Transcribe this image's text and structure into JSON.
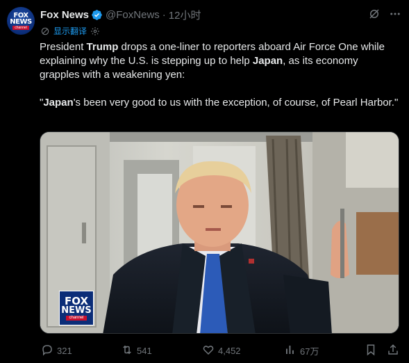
{
  "tweet": {
    "author_name": "Fox News",
    "handle": "@FoxNews",
    "separator": "·",
    "time": "12小时",
    "translate_label": "显示翻译",
    "text": {
      "p1_a": "President ",
      "p1_b": "Trump",
      "p1_c": " drops a one-liner to reporters aboard Air Force One while explaining why the U.S. is stepping up to help ",
      "p1_d": "Japan",
      "p1_e": ", as its economy grapples with a weakening yen:",
      "p2_a": "\"",
      "p2_b": "Japan",
      "p2_c": "'s been very good to us with the exception, of course, of Pearl Harbor.\""
    }
  },
  "avatar": {
    "line1": "FOX",
    "line2": "NEWS",
    "line3": "channel"
  },
  "media_logo": {
    "line1": "FOX",
    "line2": "NEWS",
    "line3": "channel"
  },
  "actions": {
    "replies": "321",
    "reposts": "541",
    "likes": "4,452",
    "views": "67万"
  },
  "colors": {
    "accent": "#1d9bf0",
    "muted": "#71767b",
    "text": "#e7e9ea",
    "background": "#000000",
    "fox_red": "#c8102e",
    "fox_blue": "#0b2d78"
  },
  "icons": [
    "verified-badge-icon",
    "grok-icon",
    "more-icon",
    "translate-icon",
    "settings-icon",
    "reply-icon",
    "repost-icon",
    "like-icon",
    "views-icon",
    "bookmark-icon",
    "share-icon"
  ]
}
